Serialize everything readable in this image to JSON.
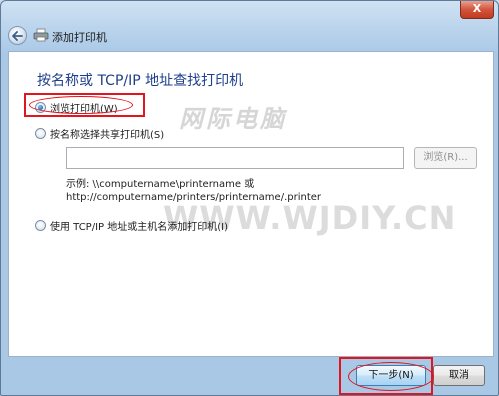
{
  "window": {
    "title": "添加打印机",
    "close_label": "X"
  },
  "main": {
    "heading": "按名称或 TCP/IP 地址查找打印机",
    "options": [
      {
        "label": "浏览打印机(W)",
        "checked": true
      },
      {
        "label": "按名称选择共享打印机(S)",
        "checked": false
      },
      {
        "label": "使用 TCP/IP 地址或主机名添加打印机(I)",
        "checked": false
      }
    ],
    "path_input": {
      "value": "",
      "placeholder": ""
    },
    "browse_label": "浏览(R)...",
    "example_line1": "示例: \\\\computername\\printername 或",
    "example_line2": "http://computername/printers/printername/.printer"
  },
  "footer": {
    "next_label": "下一步(N)",
    "cancel_label": "取消"
  },
  "watermark": {
    "site_cn": "网际电脑",
    "site_url": "WWW.WJDIY.CN"
  },
  "colors": {
    "accent": "#1d3f8b",
    "annotation": "#e2141d"
  }
}
